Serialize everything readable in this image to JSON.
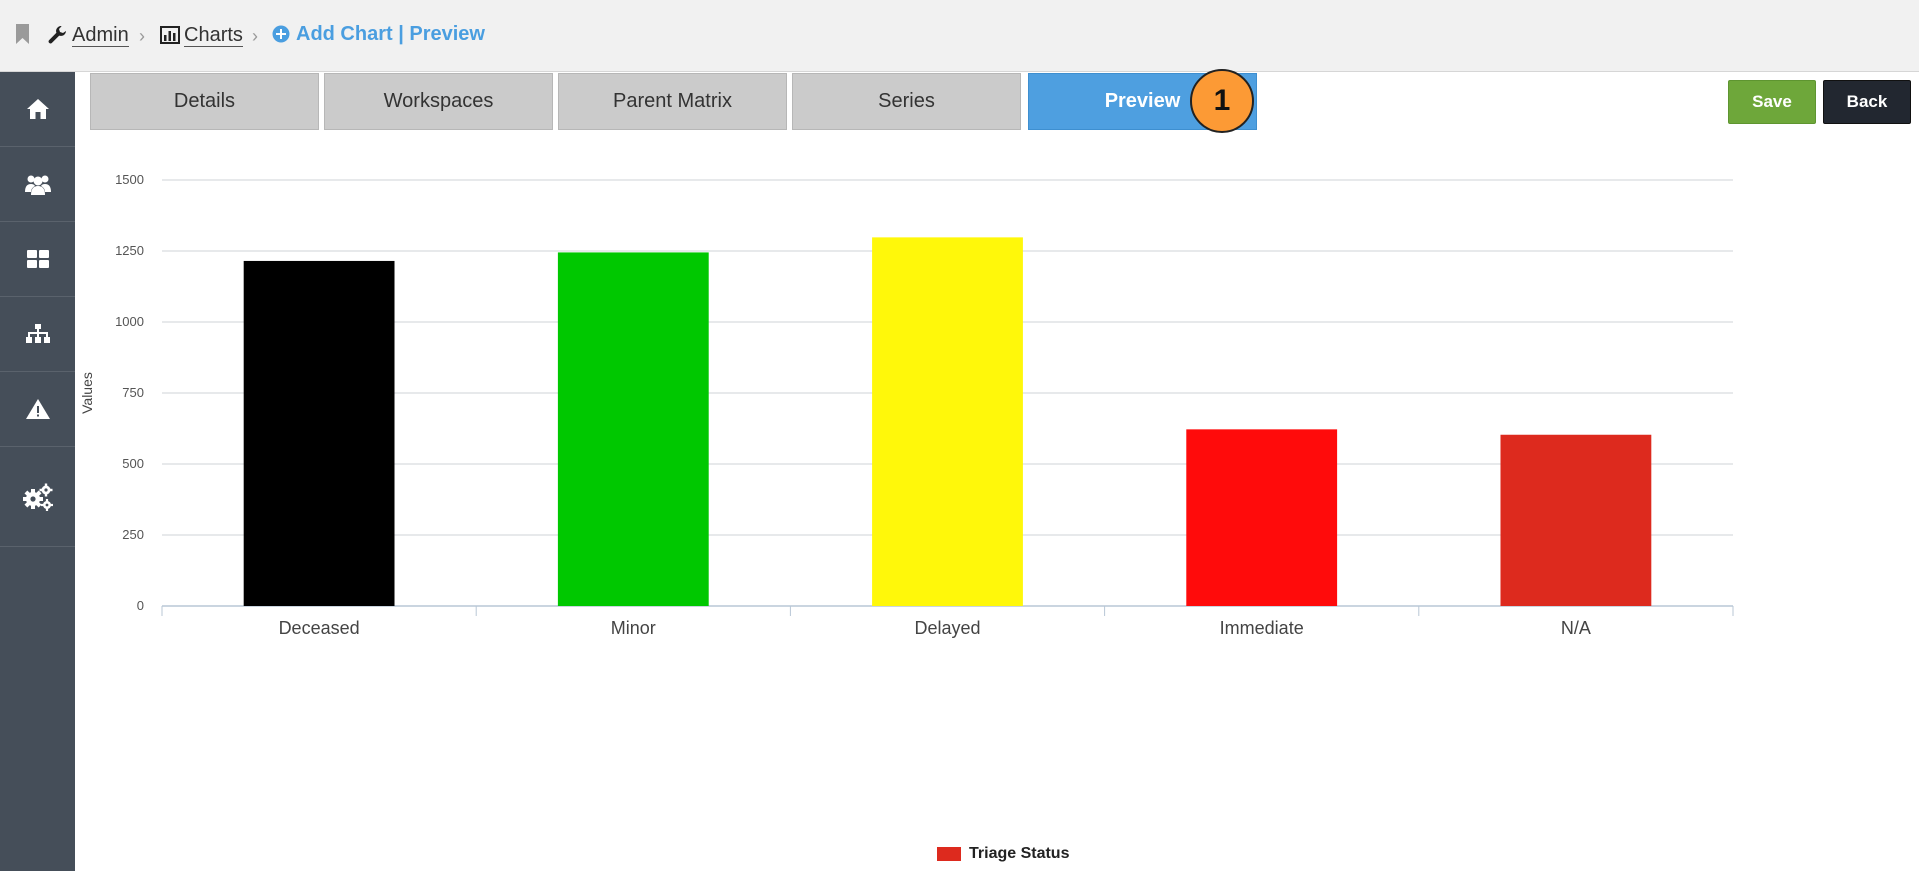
{
  "breadcrumb": {
    "items": [
      {
        "label": "Admin",
        "icon": "wrench-icon"
      },
      {
        "label": "Charts",
        "icon": "bar-chart-icon"
      }
    ],
    "current": "Add Chart | Preview",
    "current_icon": "plus-circle-icon"
  },
  "sidebar": {
    "items": [
      {
        "icon": "home-icon"
      },
      {
        "icon": "users-icon"
      },
      {
        "icon": "dashboard-icon"
      },
      {
        "icon": "sitemap-icon"
      },
      {
        "icon": "warning-icon"
      },
      {
        "icon": "gears-icon"
      }
    ]
  },
  "tabs": [
    {
      "label": "Details"
    },
    {
      "label": "Workspaces"
    },
    {
      "label": "Parent Matrix"
    },
    {
      "label": "Series"
    },
    {
      "label": "Preview",
      "active": true
    }
  ],
  "step_badge": "1",
  "actions": {
    "save_label": "Save",
    "back_label": "Back"
  },
  "colors": {
    "accent": "#4e9fe0",
    "save": "#6ea73a",
    "back": "#222730",
    "sidebar": "#454e59",
    "badge": "#fc9a35"
  },
  "chart_data": {
    "type": "bar",
    "categories": [
      "Deceased",
      "Minor",
      "Delayed",
      "Immediate",
      "N/A"
    ],
    "values": [
      1215,
      1245,
      1298,
      622,
      603
    ],
    "bar_colors": [
      "#000000",
      "#00c800",
      "#fff80a",
      "#ff0b0b",
      "#dd2a1e"
    ],
    "ylabel": "Values",
    "ylim": [
      0,
      1500
    ],
    "yticks": [
      0,
      250,
      500,
      750,
      1000,
      1250,
      1500
    ],
    "grid": true,
    "legend": {
      "label": "Triage Status",
      "color": "#dd2a1e",
      "placement": "bottom-center"
    }
  }
}
